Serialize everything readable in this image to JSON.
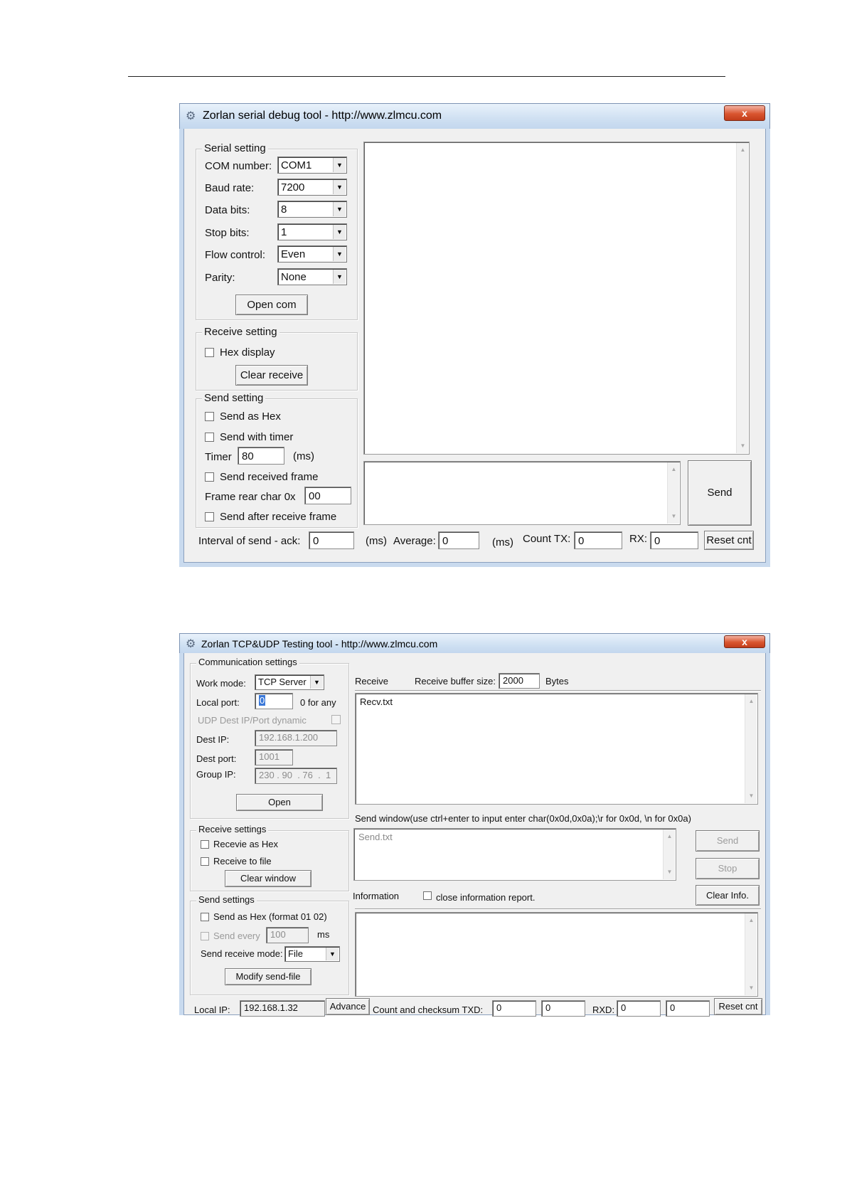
{
  "serial": {
    "title": "Zorlan serial debug tool - http://www.zlmcu.com",
    "close": "x",
    "serial_setting": {
      "title": "Serial setting",
      "com_label": "COM number:",
      "com_value": "COM1",
      "baud_label": "Baud rate:",
      "baud_value": "7200",
      "data_label": "Data bits:",
      "data_value": "8",
      "stop_label": "Stop bits:",
      "stop_value": "1",
      "flow_label": "Flow control:",
      "flow_value": "Even",
      "parity_label": "Parity:",
      "parity_value": "None",
      "open_button": "Open com"
    },
    "receive_setting": {
      "title": "Receive setting",
      "hex_display": "Hex display",
      "clear_button": "Clear receive"
    },
    "send_setting": {
      "title": "Send setting",
      "send_as_hex": "Send as Hex",
      "send_with_timer": "Send with timer",
      "timer_label": "Timer",
      "timer_value": "80",
      "timer_unit": "(ms)",
      "send_received_frame": "Send received frame",
      "frame_rear_label": "Frame rear char 0x",
      "frame_rear_value": "00",
      "send_after_receive": "Send after receive frame"
    },
    "send_button": "Send",
    "status": {
      "interval_label": "Interval of send - ack:",
      "interval_value": "0",
      "ms1": "(ms)",
      "average_label": "Average:",
      "average_value": "0",
      "ms2": "(ms)",
      "count_tx_label": "Count TX:",
      "count_tx_value": "0",
      "rx_label": "RX:",
      "rx_value": "0",
      "reset_button": "Reset cnt"
    }
  },
  "tcp": {
    "title": "Zorlan TCP&UDP Testing tool - http://www.zlmcu.com",
    "close": "x",
    "comm": {
      "title": "Communication settings",
      "work_mode_label": "Work mode:",
      "work_mode_value": "TCP Server",
      "local_port_label": "Local port:",
      "local_port_value": "0",
      "local_port_hint": "0 for any",
      "udp_dynamic": "UDP Dest IP/Port dynamic",
      "dest_ip_label": "Dest IP:",
      "dest_ip_value": "192.168.1.200",
      "dest_port_label": "Dest port:",
      "dest_port_value": "1001",
      "group_ip_label": "Group IP:",
      "group_ip_value": "230 . 90  . 76  .  1",
      "open_button": "Open"
    },
    "recv_settings": {
      "title": "Receive settings",
      "receive_as_hex": "Recevie as Hex",
      "receive_to_file": "Receive to file",
      "clear_button": "Clear window"
    },
    "send_settings": {
      "title": "Send settings",
      "send_as_hex": "Send as Hex (format 01 02)",
      "send_every": "Send every",
      "send_every_value": "100",
      "send_every_unit": "ms",
      "send_mode_label": "Send receive mode:",
      "send_mode_value": "File",
      "modify_button": "Modify send-file"
    },
    "receive": {
      "label": "Receive",
      "buffer_label": "Receive buffer size:",
      "buffer_value": "2000",
      "buffer_unit": "Bytes",
      "text": "Recv.txt"
    },
    "send_window": {
      "label": "Send window(use ctrl+enter to input enter char(0x0d,0x0a);\\r for 0x0d, \\n for 0x0a)",
      "text": "Send.txt",
      "send_button": "Send",
      "stop_button": "Stop"
    },
    "info": {
      "label": "Information",
      "close_report": "close information report.",
      "clear_button": "Clear Info."
    },
    "status": {
      "local_ip_label": "Local IP:",
      "local_ip_value": "192.168.1.32",
      "advance_button": "Advance",
      "count_label": "Count and checksum TXD:",
      "txd1": "0",
      "txd2": "0",
      "rxd_label": "RXD:",
      "rxd1": "0",
      "rxd2": "0",
      "reset_button": "Reset cnt"
    }
  }
}
